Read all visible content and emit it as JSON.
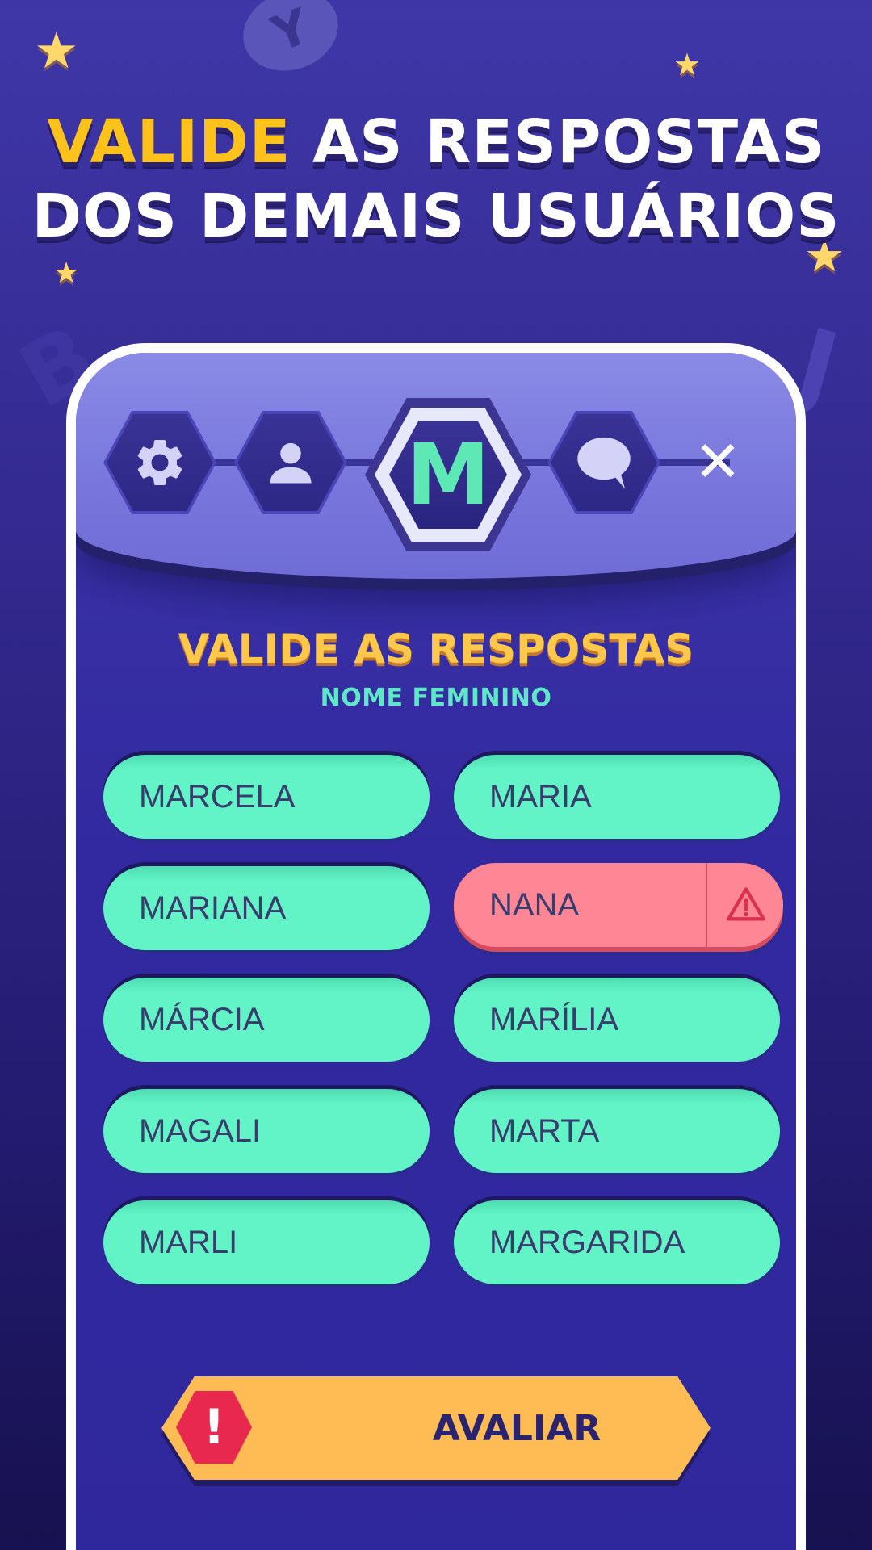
{
  "promo": {
    "headline_highlight": "VALIDE",
    "headline_rest_line1": " AS RESPOSTAS",
    "headline_line2": "DOS DEMAIS USUÁRIOS"
  },
  "background_letters": [
    "Y",
    "B",
    "J"
  ],
  "nav": {
    "items": [
      {
        "icon": "gear-icon"
      },
      {
        "icon": "user-icon"
      },
      {
        "letter": "M"
      },
      {
        "icon": "chat-icon"
      }
    ],
    "close_label": "✕"
  },
  "validation": {
    "title": "VALIDE AS RESPOSTAS",
    "category": "NOME FEMININO",
    "answers": [
      {
        "text": "MARCELA",
        "status": "valid"
      },
      {
        "text": "MARIA",
        "status": "valid"
      },
      {
        "text": "MARIANA",
        "status": "valid"
      },
      {
        "text": "NANA",
        "status": "flagged"
      },
      {
        "text": "MÁRCIA",
        "status": "valid"
      },
      {
        "text": "MARÍLIA",
        "status": "valid"
      },
      {
        "text": "MAGALI",
        "status": "valid"
      },
      {
        "text": "MARTA",
        "status": "valid"
      },
      {
        "text": "MARLI",
        "status": "valid"
      },
      {
        "text": "MARGARIDA",
        "status": "valid"
      }
    ],
    "submit_label": "AVALIAR",
    "submit_icon": "!"
  },
  "colors": {
    "background": "#3f37a8",
    "highlight": "#ffc21a",
    "valid_answer": "#62f4c6",
    "flagged_answer": "#ff8795",
    "submit_button": "#ffbc55",
    "accent_letter": "#5ee8b6"
  }
}
